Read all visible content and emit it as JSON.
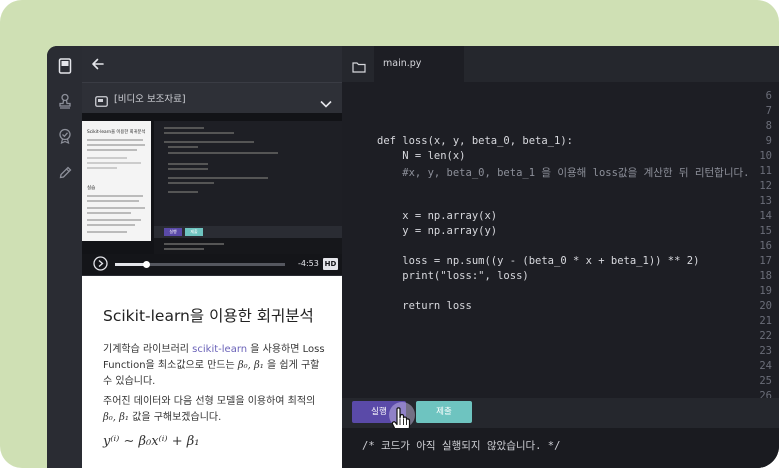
{
  "selector": {
    "label": "[비디오 보조자료]"
  },
  "video": {
    "time": "-4:53",
    "quality": "HD",
    "progress_fraction": 0.18,
    "thumb_title": "Scikit-learn을 이용한 회귀분석",
    "thumb_heading": "실습",
    "thumb_run": "실행",
    "thumb_submit": "제출"
  },
  "doc": {
    "title": "Scikit-learn을 이용한 회귀분석",
    "p1_a": "기계학습 라이브러리 ",
    "p1_link": "scikit-learn",
    "p1_b": " 을 사용하면 Loss Function을 최소값으로 만드는 ",
    "p1_math": "β₀, β₁",
    "p1_c": " 을 쉽게 구할 수 있습니다.",
    "p2_a": "주어진 데이터와 다음 선형 모델을 이용하여 최적의 ",
    "p2_math": "β₀, β₁",
    "p2_b": " 값을 구해보겠습니다.",
    "formula": "y⁽ⁱ⁾ ∼ β₀x⁽ⁱ⁾ + β₁"
  },
  "editor": {
    "tab": "main.py",
    "lines": [
      {
        "n": "6",
        "code": ""
      },
      {
        "n": "7",
        "code": ""
      },
      {
        "n": "8",
        "code": ""
      },
      {
        "n": "9",
        "code": "def loss(x, y, beta_0, beta_1):"
      },
      {
        "n": "10",
        "code": "    N = len(x)"
      },
      {
        "n": "11",
        "code": "    #x, y, beta_0, beta_1 을 이용해 loss값을 계산한 뒤 리턴합니다."
      },
      {
        "n": "12",
        "code": ""
      },
      {
        "n": "13",
        "code": ""
      },
      {
        "n": "14",
        "code": "    x = np.array(x)"
      },
      {
        "n": "15",
        "code": "    y = np.array(y)"
      },
      {
        "n": "16",
        "code": ""
      },
      {
        "n": "17",
        "code": "    loss = np.sum((y - (beta_0 * x + beta_1)) ** 2)"
      },
      {
        "n": "18",
        "code": "    print(\"loss:\", loss)"
      },
      {
        "n": "19",
        "code": ""
      },
      {
        "n": "20",
        "code": "    return loss"
      },
      {
        "n": "21",
        "code": ""
      },
      {
        "n": "22",
        "code": ""
      },
      {
        "n": "23",
        "code": ""
      },
      {
        "n": "24",
        "code": ""
      },
      {
        "n": "25",
        "code": ""
      },
      {
        "n": "26",
        "code": ""
      }
    ],
    "run_label": "실행",
    "submit_label": "제출",
    "console_msg": "/* 코드가 아직 실행되지 않았습니다. */"
  },
  "colors": {
    "run": "#5a4aa8",
    "submit": "#6ec4c0",
    "background": "#cfe0b4"
  }
}
